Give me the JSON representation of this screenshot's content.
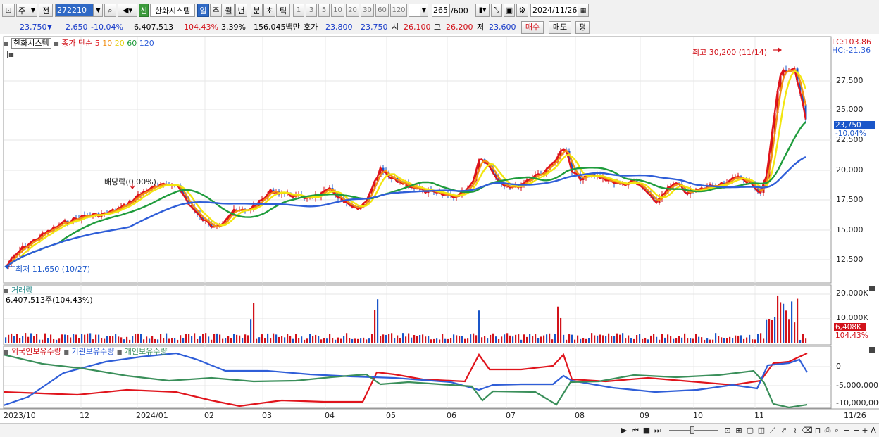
{
  "toolbar": {
    "market_labels": [
      "주",
      "전"
    ],
    "code": "272210",
    "badge": "신",
    "name": "한화시스템",
    "periods": [
      "일",
      "주",
      "월",
      "년",
      "분",
      "초",
      "틱"
    ],
    "active_period": "일",
    "intervals": [
      "1",
      "3",
      "5",
      "10",
      "20",
      "30",
      "60",
      "120"
    ],
    "count": "265",
    "count_max": "/600",
    "date": "2024/11/26"
  },
  "quote": {
    "price": "23,750",
    "change": "2,650",
    "change_pct": "-10.04%",
    "volume": "6,407,513",
    "volume_ratio": "104.43%",
    "turnover_pct": "3.39%",
    "amount": "156,045백만",
    "hoga_label": "호가",
    "ask": "23,800",
    "bid": "23,750",
    "open_label": "시",
    "open": "26,100",
    "high_label": "고",
    "high": "26,200",
    "low_label": "저",
    "low": "23,600",
    "buy_label": "매수",
    "sell_label": "매도",
    "avg_label": "평"
  },
  "price_panel": {
    "title": "한화시스템",
    "ma_label": "종가 단순",
    "ma_periods": [
      "5",
      "10",
      "20",
      "60",
      "120"
    ],
    "lc": "LC:103.86",
    "hc": "HC:-21.36",
    "y_ticks": [
      "27,500",
      "25,000",
      "22,500",
      "20,000",
      "17,500",
      "15,000",
      "12,500"
    ],
    "last_price": "23,750",
    "last_change": "-10.04%",
    "annot_high": "최고 30,200 (11/14)",
    "annot_low": "최저 11,650 (10/27)",
    "annot_div": "배당락(0.00%)"
  },
  "volume_panel": {
    "title": "거래량",
    "value": "6,407,513주(104.43%)",
    "y_ticks": [
      "20,000K",
      "10,000K"
    ],
    "last": "6,408K",
    "last_pct": "104.43%"
  },
  "holding_panel": {
    "series": [
      "외국인보유수량",
      "기관보유수량",
      "개인보유수량"
    ],
    "y_ticks": [
      "0",
      "-5,000,000",
      "-10,000,000"
    ]
  },
  "x_axis": [
    "2023/10",
    "12",
    "2024/01",
    "02",
    "03",
    "04",
    "05",
    "06",
    "07",
    "08",
    "09",
    "10",
    "11",
    "11/26"
  ],
  "colors": {
    "ma5": "#e0141c",
    "ma10": "#f29015",
    "ma20": "#f2e60f",
    "ma60": "#1f9c3c",
    "ma120": "#2f5ed8",
    "up": "#d2121a",
    "down": "#1a56c9",
    "foreign": "#e0141c",
    "institution": "#2f5ed8",
    "individual": "#3a8f5a"
  }
}
